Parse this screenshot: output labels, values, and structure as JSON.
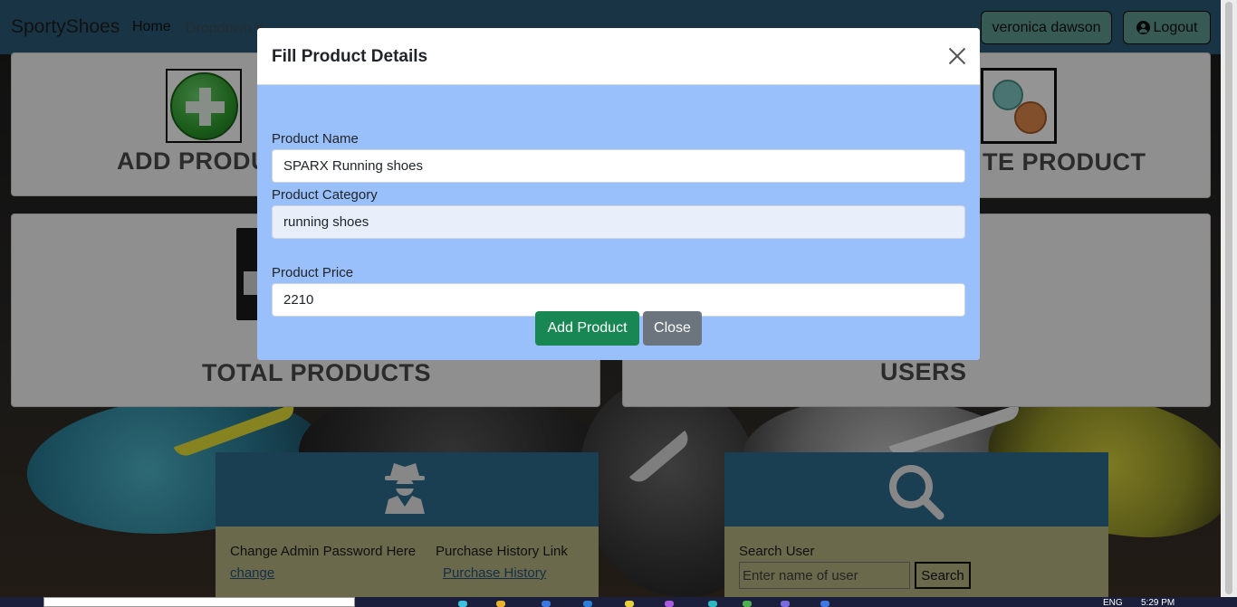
{
  "navbar": {
    "brand": "SportyShoes",
    "home": "Home",
    "dropdown": "Dropdown",
    "user": "veronica dawson",
    "logout": "Logout"
  },
  "cards": {
    "add_title": "ADD PRODU",
    "update_title": "TE PRODUCT",
    "total_title": "TOTAL PRODUCTS",
    "users_title": "USERS"
  },
  "admin_panel": {
    "change_label": "Change Admin Password Here",
    "change_link": "change",
    "history_label": "Purchase History Link",
    "history_link": "Purchase History"
  },
  "search_panel": {
    "label": "Search User",
    "placeholder": "Enter name of user",
    "button": "Search"
  },
  "modal": {
    "title": "Fill Product Details",
    "name_label": "Product Name",
    "name_value": "SPARX Running shoes",
    "category_label": "Product Category",
    "category_value": "running shoes",
    "price_label": "Product Price",
    "price_value": "2210",
    "add_button": "Add Product",
    "close_button": "Close"
  },
  "taskbar": {
    "lang": "ENG",
    "time": "5:29 PM"
  },
  "colors": {
    "navbar": "#2c5c78",
    "modal_body": "#9ac0fb",
    "add_button": "#198754",
    "close_button": "#6c757d",
    "panel_head": "#2d6c8e"
  }
}
